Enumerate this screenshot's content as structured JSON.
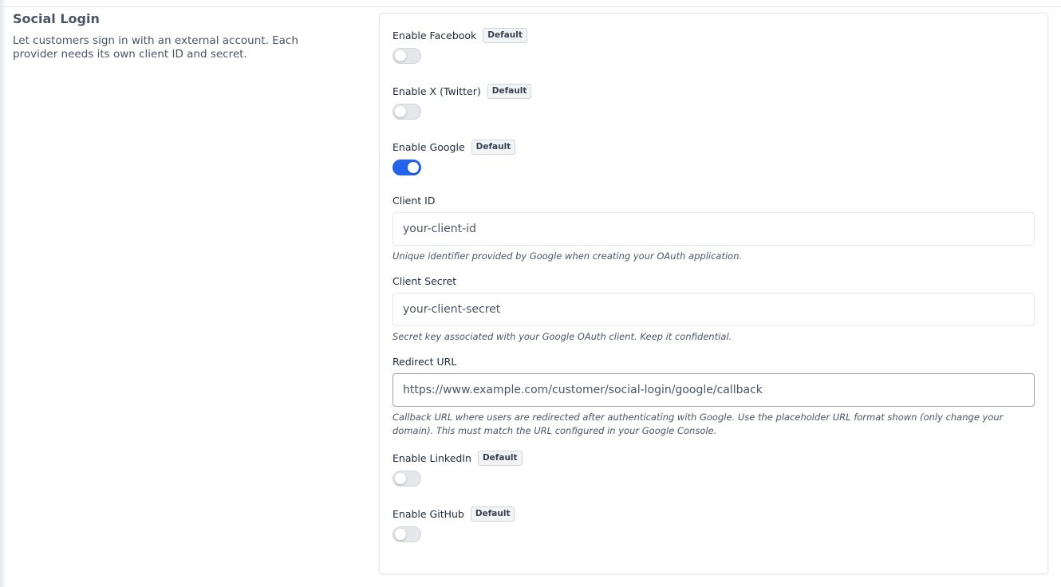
{
  "section": {
    "title": "Social Login",
    "description": "Let customers sign in with an external account. Each provider needs its own client ID and secret."
  },
  "badge_label": "Default",
  "facebook": {
    "label": "Enable Facebook",
    "enabled": false
  },
  "twitter": {
    "label": "Enable X (Twitter)",
    "enabled": false
  },
  "google": {
    "label": "Enable Google",
    "enabled": true,
    "client_id": {
      "label": "Client ID",
      "placeholder": "your-client-id",
      "hint": "Unique identifier provided by Google when creating your OAuth application."
    },
    "client_secret": {
      "label": "Client Secret",
      "placeholder": "your-client-secret",
      "hint": "Secret key associated with your Google OAuth client. Keep it confidential."
    },
    "redirect_url": {
      "label": "Redirect URL",
      "value": "https://www.example.com/customer/social-login/google/callback",
      "hint": "Callback URL where users are redirected after authenticating with Google. Use the placeholder URL format shown (only change your domain). This must match the URL configured in your Google Console."
    }
  },
  "linkedin": {
    "label": "Enable LinkedIn",
    "enabled": false
  },
  "github": {
    "label": "Enable GitHub",
    "enabled": false
  },
  "colors": {
    "accent": "#2563eb",
    "toggle_off": "#e5e7eb"
  }
}
